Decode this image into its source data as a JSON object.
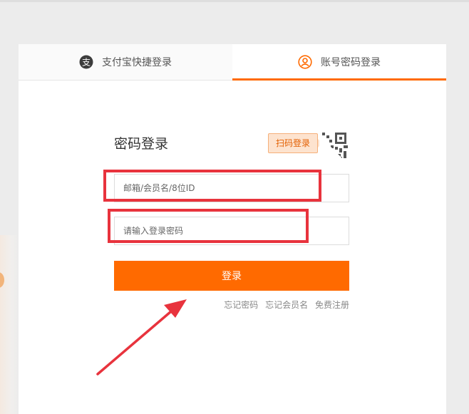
{
  "tabs": [
    {
      "label": "支付宝快捷登录",
      "icon": "alipay-icon",
      "active": false
    },
    {
      "label": "账号密码登录",
      "icon": "user-circle-icon",
      "active": true
    }
  ],
  "form": {
    "title": "密码登录",
    "qr_tip": "扫码登录",
    "qr_icon": "qrcode-icon",
    "username_placeholder": "邮箱/会员名/8位ID",
    "password_placeholder": "请输入登录密码",
    "submit_label": "登录"
  },
  "links": {
    "forgot_password": "忘记密码",
    "forgot_username": "忘记会员名",
    "register": "免费注册"
  },
  "colors": {
    "accent": "#ff6a00",
    "annotation": "#e8333d"
  }
}
